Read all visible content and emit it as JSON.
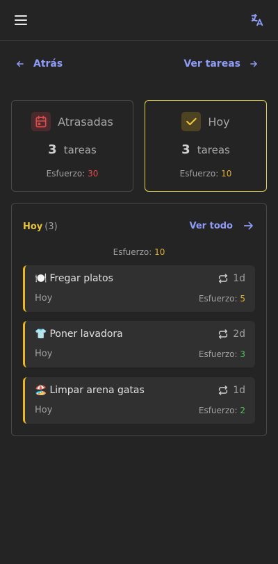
{
  "nav": {
    "back_label": "Atrás",
    "tasks_label": "Ver tareas"
  },
  "cards": {
    "overdue": {
      "title": "Atrasadas",
      "count": "3",
      "count_unit": "tareas",
      "effort_label": "Esfuerzo:",
      "effort_value": "30",
      "icon": "calendar-icon",
      "accent": "#e34b4b"
    },
    "today": {
      "title": "Hoy",
      "count": "3",
      "count_unit": "tareas",
      "effort_label": "Esfuerzo:",
      "effort_value": "10",
      "icon": "check-icon",
      "accent": "#e7d649"
    }
  },
  "panel": {
    "title": "Hoy",
    "count": "(3)",
    "see_all_label": "Ver todo",
    "effort_label": "Esfuerzo:",
    "effort_value": "10",
    "tasks": [
      {
        "emoji": "🍽️",
        "name": "Fregar platos",
        "repeat": "1d",
        "day": "Hoy",
        "effort_label": "Esfuerzo:",
        "effort_value": "5",
        "effort_color": "#e0b02b"
      },
      {
        "emoji": "👕",
        "name": "Poner lavadora",
        "repeat": "2d",
        "day": "Hoy",
        "effort_label": "Esfuerzo:",
        "effort_value": "3",
        "effort_color": "#4fc25a"
      },
      {
        "emoji": "🏖️",
        "name": "Limpar arena gatas",
        "repeat": "1d",
        "day": "Hoy",
        "effort_label": "Esfuerzo:",
        "effort_value": "2",
        "effort_color": "#4fc25a"
      }
    ]
  }
}
